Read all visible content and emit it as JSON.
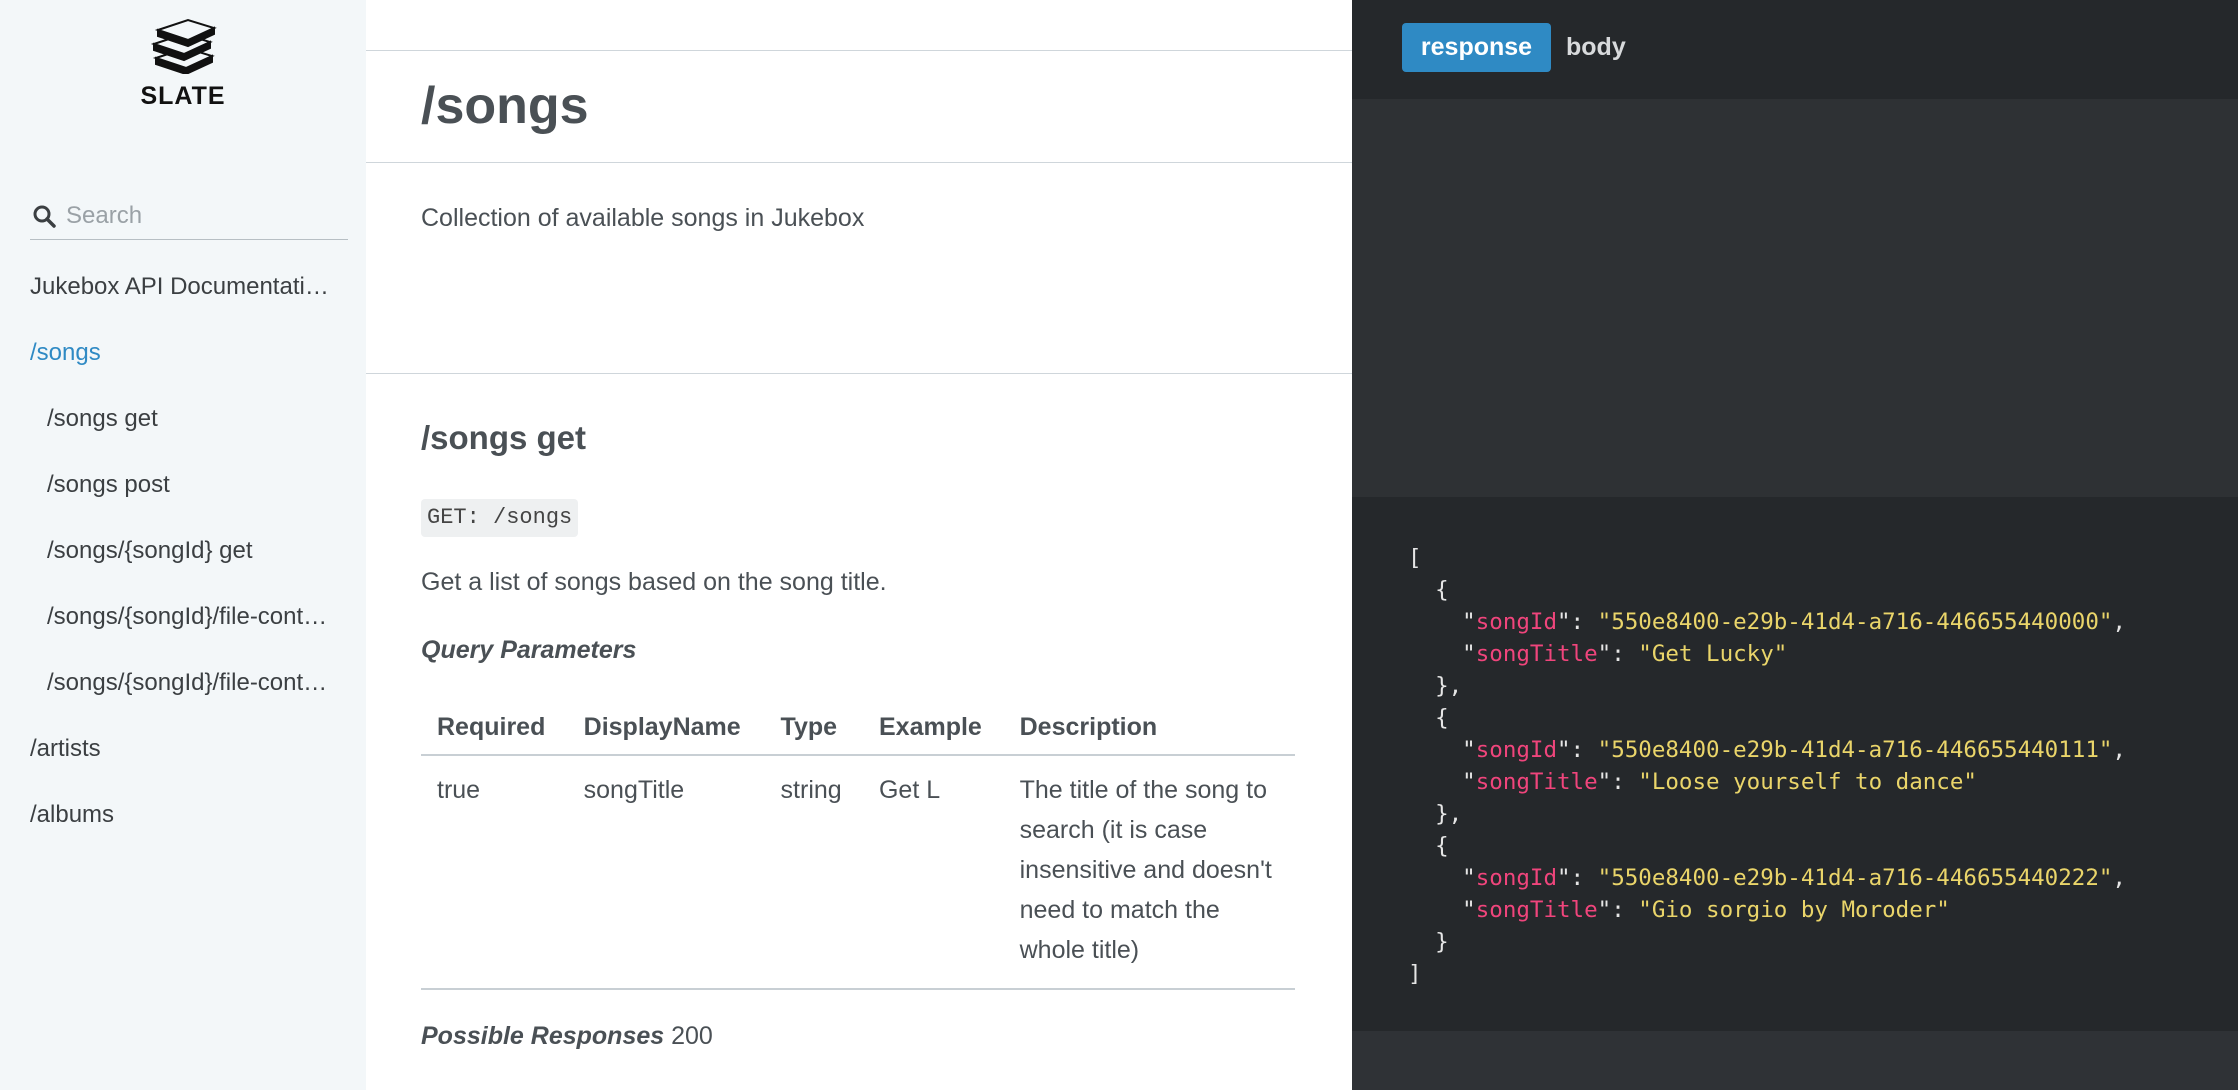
{
  "sidebar": {
    "logo_text": "SLATE",
    "search_placeholder": "Search",
    "toc": [
      {
        "label": "Jukebox API Documentation",
        "level": 0,
        "active": false
      },
      {
        "label": "/songs",
        "level": 0,
        "active": true
      },
      {
        "label": "/songs get",
        "level": 1,
        "active": false
      },
      {
        "label": "/songs post",
        "level": 1,
        "active": false
      },
      {
        "label": "/songs/{songId} get",
        "level": 1,
        "active": false
      },
      {
        "label": "/songs/{songId}/file-content get",
        "level": 1,
        "active": false
      },
      {
        "label": "/songs/{songId}/file-content post",
        "level": 1,
        "active": false
      },
      {
        "label": "/artists",
        "level": 0,
        "active": false
      },
      {
        "label": "/albums",
        "level": 0,
        "active": false
      }
    ]
  },
  "main": {
    "title": "/songs",
    "description": "Collection of available songs in Jukebox",
    "method": {
      "title": "/songs get",
      "request_line": "GET: /songs",
      "description": "Get a list of songs based on the song title.",
      "params_title": "Query Parameters",
      "params_table": {
        "headers": [
          "Required",
          "DisplayName",
          "Type",
          "Example",
          "Description"
        ],
        "rows": [
          [
            "true",
            "songTitle",
            "string",
            "Get L",
            "The title of the song to search (it is case insensitive and doesn't need to match the whole title)"
          ]
        ]
      },
      "responses_label": "Possible Responses",
      "responses_value": "200"
    }
  },
  "code_panel": {
    "tabs": [
      "response",
      "body"
    ],
    "active_tab": "response",
    "json_example": [
      {
        "songId": "550e8400-e29b-41d4-a716-446655440000",
        "songTitle": "Get Lucky"
      },
      {
        "songId": "550e8400-e29b-41d4-a716-446655440111",
        "songTitle": "Loose yourself to dance"
      },
      {
        "songId": "550e8400-e29b-41d4-a716-446655440222",
        "songTitle": "Gio sorgio by Moroder"
      }
    ]
  },
  "colors": {
    "accent": "#2f8ac4",
    "sidebar_bg": "#f3f7f9",
    "dark_bg": "#2f3236",
    "code_key": "#f0457c",
    "code_string": "#ead56a"
  }
}
